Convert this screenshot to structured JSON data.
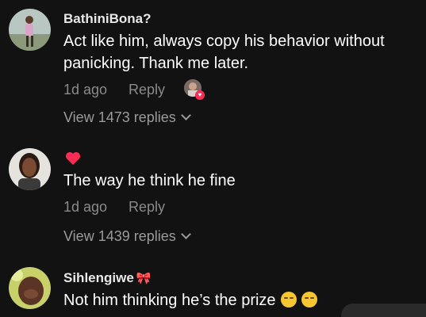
{
  "comments": [
    {
      "username": "BathiniBona?",
      "text": "Act like him, always copy his behavior without panicking. Thank me later.",
      "time": "1d ago",
      "reply_label": "Reply",
      "view_replies": "View 1473 replies"
    },
    {
      "username": "",
      "text": "The way he think he fine",
      "time": "1d ago",
      "reply_label": "Reply",
      "view_replies": "View 1439 replies"
    },
    {
      "username": "Sihlengiwe",
      "text": "Not him thinking he’s the prize"
    }
  ],
  "colors": {
    "background": "#121212",
    "meta_gray": "#8a8a8a",
    "like_red": "#fe2c55"
  },
  "icons": {
    "creator_like": "creator-liked-avatar-icon",
    "heart": "heart-icon",
    "bow": "ribbon-icon",
    "emoji": "pensive-face-icon",
    "chevron": "chevron-down-icon"
  }
}
